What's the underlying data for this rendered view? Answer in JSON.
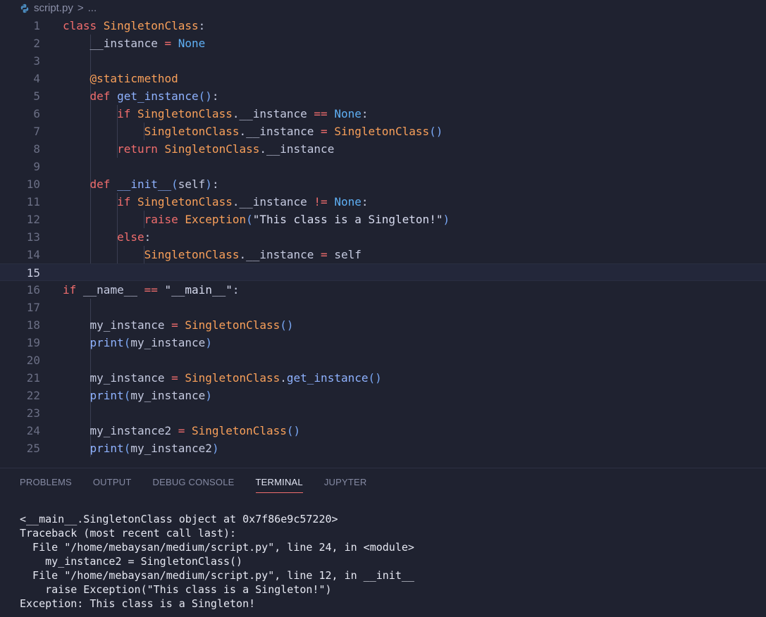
{
  "breadcrumb": {
    "file": "script.py",
    "separator": ">",
    "more": "..."
  },
  "editor": {
    "current_line": 15,
    "lines": [
      {
        "n": "1",
        "segs": [
          [
            "k",
            "class "
          ],
          [
            "c",
            "SingletonClass"
          ],
          [
            "v",
            ":"
          ]
        ]
      },
      {
        "n": "2",
        "indent": 1,
        "segs": [
          [
            "v",
            "    __instance "
          ],
          [
            "o",
            "= "
          ],
          [
            "n",
            "None"
          ]
        ]
      },
      {
        "n": "3",
        "indent": 1,
        "segs": []
      },
      {
        "n": "4",
        "indent": 1,
        "segs": [
          [
            "v",
            "    "
          ],
          [
            "d",
            "@staticmethod"
          ]
        ]
      },
      {
        "n": "5",
        "indent": 1,
        "segs": [
          [
            "v",
            "    "
          ],
          [
            "k",
            "def "
          ],
          [
            "f",
            "get_instance"
          ],
          [
            "p",
            "()"
          ],
          [
            "v",
            ":"
          ]
        ]
      },
      {
        "n": "6",
        "indent": 2,
        "segs": [
          [
            "v",
            "        "
          ],
          [
            "k",
            "if "
          ],
          [
            "c",
            "SingletonClass"
          ],
          [
            "v",
            ".__instance "
          ],
          [
            "o",
            "== "
          ],
          [
            "n",
            "None"
          ],
          [
            "v",
            ":"
          ]
        ]
      },
      {
        "n": "7",
        "indent": 3,
        "segs": [
          [
            "v",
            "            "
          ],
          [
            "c",
            "SingletonClass"
          ],
          [
            "v",
            ".__instance "
          ],
          [
            "o",
            "= "
          ],
          [
            "c",
            "SingletonClass"
          ],
          [
            "p",
            "()"
          ]
        ]
      },
      {
        "n": "8",
        "indent": 2,
        "segs": [
          [
            "v",
            "        "
          ],
          [
            "k",
            "return "
          ],
          [
            "c",
            "SingletonClass"
          ],
          [
            "v",
            ".__instance"
          ]
        ]
      },
      {
        "n": "9",
        "indent": 1,
        "segs": []
      },
      {
        "n": "10",
        "indent": 1,
        "segs": [
          [
            "v",
            "    "
          ],
          [
            "k",
            "def "
          ],
          [
            "f",
            "__init__"
          ],
          [
            "p",
            "("
          ],
          [
            "v",
            "self"
          ],
          [
            "p",
            ")"
          ],
          [
            "v",
            ":"
          ]
        ]
      },
      {
        "n": "11",
        "indent": 2,
        "segs": [
          [
            "v",
            "        "
          ],
          [
            "k",
            "if "
          ],
          [
            "c",
            "SingletonClass"
          ],
          [
            "v",
            ".__instance "
          ],
          [
            "o",
            "!= "
          ],
          [
            "n",
            "None"
          ],
          [
            "v",
            ":"
          ]
        ]
      },
      {
        "n": "12",
        "indent": 3,
        "segs": [
          [
            "v",
            "            "
          ],
          [
            "k",
            "raise "
          ],
          [
            "c",
            "Exception"
          ],
          [
            "p",
            "("
          ],
          [
            "s",
            "\"This class is a Singleton!\""
          ],
          [
            "p",
            ")"
          ]
        ]
      },
      {
        "n": "13",
        "indent": 2,
        "segs": [
          [
            "v",
            "        "
          ],
          [
            "k",
            "else"
          ],
          [
            "v",
            ":"
          ]
        ]
      },
      {
        "n": "14",
        "indent": 3,
        "segs": [
          [
            "v",
            "            "
          ],
          [
            "c",
            "SingletonClass"
          ],
          [
            "v",
            ".__instance "
          ],
          [
            "o",
            "= "
          ],
          [
            "v",
            "self"
          ]
        ]
      },
      {
        "n": "15",
        "segs": []
      },
      {
        "n": "16",
        "segs": [
          [
            "k",
            "if "
          ],
          [
            "v",
            "__name__ "
          ],
          [
            "o",
            "== "
          ],
          [
            "s",
            "\"__main__\""
          ],
          [
            "v",
            ":"
          ]
        ]
      },
      {
        "n": "17",
        "indent": 1,
        "segs": []
      },
      {
        "n": "18",
        "indent": 1,
        "segs": [
          [
            "v",
            "    my_instance "
          ],
          [
            "o",
            "= "
          ],
          [
            "c",
            "SingletonClass"
          ],
          [
            "p",
            "()"
          ]
        ]
      },
      {
        "n": "19",
        "indent": 1,
        "segs": [
          [
            "v",
            "    "
          ],
          [
            "f",
            "print"
          ],
          [
            "p",
            "("
          ],
          [
            "v",
            "my_instance"
          ],
          [
            "p",
            ")"
          ]
        ]
      },
      {
        "n": "20",
        "indent": 1,
        "segs": []
      },
      {
        "n": "21",
        "indent": 1,
        "segs": [
          [
            "v",
            "    my_instance "
          ],
          [
            "o",
            "= "
          ],
          [
            "c",
            "SingletonClass"
          ],
          [
            "v",
            "."
          ],
          [
            "f",
            "get_instance"
          ],
          [
            "p",
            "()"
          ]
        ]
      },
      {
        "n": "22",
        "indent": 1,
        "segs": [
          [
            "v",
            "    "
          ],
          [
            "f",
            "print"
          ],
          [
            "p",
            "("
          ],
          [
            "v",
            "my_instance"
          ],
          [
            "p",
            ")"
          ]
        ]
      },
      {
        "n": "23",
        "indent": 1,
        "segs": []
      },
      {
        "n": "24",
        "indent": 1,
        "segs": [
          [
            "v",
            "    my_instance2 "
          ],
          [
            "o",
            "= "
          ],
          [
            "c",
            "SingletonClass"
          ],
          [
            "p",
            "()"
          ]
        ]
      },
      {
        "n": "25",
        "indent": 1,
        "segs": [
          [
            "v",
            "    "
          ],
          [
            "f",
            "print"
          ],
          [
            "p",
            "("
          ],
          [
            "v",
            "my_instance2"
          ],
          [
            "p",
            ")"
          ]
        ]
      }
    ]
  },
  "panel": {
    "tabs": [
      "PROBLEMS",
      "OUTPUT",
      "DEBUG CONSOLE",
      "TERMINAL",
      "JUPYTER"
    ],
    "active_tab": "TERMINAL",
    "terminal": [
      "<__main__.SingletonClass object at 0x7f86e9c57220>",
      "Traceback (most recent call last):",
      "  File \"/home/mebaysan/medium/script.py\", line 24, in <module>",
      "    my_instance2 = SingletonClass()",
      "  File \"/home/mebaysan/medium/script.py\", line 12, in __init__",
      "    raise Exception(\"This class is a Singleton!\")",
      "Exception: This class is a Singleton!"
    ]
  },
  "colors": {
    "background": "#1f2230",
    "accent": "#f06d6d",
    "python_icon": "#4b8bbe"
  },
  "icons": {
    "file_icon": "python-file-icon",
    "breadcrumb_chevron": "chevron-right-icon"
  }
}
